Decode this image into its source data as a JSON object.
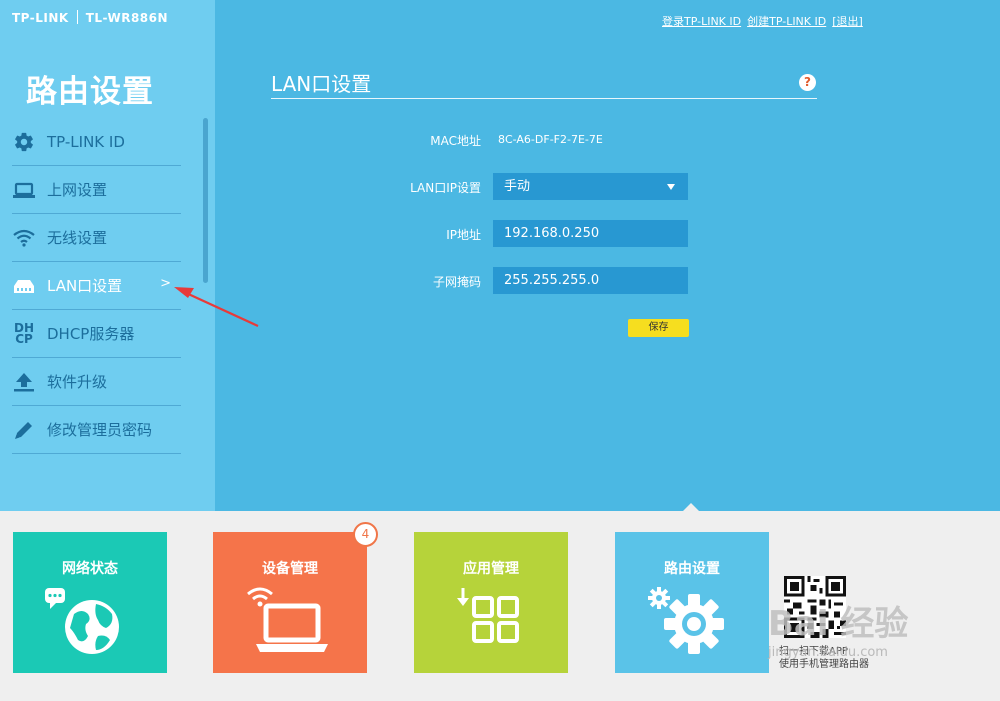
{
  "brand": {
    "logo": "TP-LINK",
    "model": "TL-WR886N"
  },
  "top_links": {
    "login": "登录TP-LINK ID",
    "create": "创建TP-LINK ID",
    "logout": "[退出]"
  },
  "sidebar": {
    "title": "路由设置",
    "items": [
      {
        "label": "TP-LINK ID",
        "icon": "gear-icon"
      },
      {
        "label": "上网设置",
        "icon": "laptop-icon"
      },
      {
        "label": "无线设置",
        "icon": "wifi-icon"
      },
      {
        "label": "LAN口设置",
        "icon": "router-icon",
        "active": true,
        "chevron": ">"
      },
      {
        "label": "DHCP服务器",
        "icon": "dhcp-icon",
        "icon_text": "DH CP"
      },
      {
        "label": "软件升级",
        "icon": "upload-icon"
      },
      {
        "label": "修改管理员密码",
        "icon": "pencil-icon"
      }
    ]
  },
  "panel": {
    "title": "LAN口设置",
    "help": "?",
    "mac_label": "MAC地址",
    "mac_value": "8C-A6-DF-F2-7E-7E",
    "ip_mode_label": "LAN口IP设置",
    "ip_mode_value": "手动",
    "ip_label": "IP地址",
    "ip_value": "192.168.0.250",
    "mask_label": "子网掩码",
    "mask_value": "255.255.255.0",
    "save": "保存"
  },
  "tiles": [
    {
      "label": "网络状态",
      "color": "#1bc9b5",
      "icon": "globe-icon"
    },
    {
      "label": "设备管理",
      "color": "#f5744a",
      "icon": "laptop-wifi-icon",
      "badge": "4"
    },
    {
      "label": "应用管理",
      "color": "#b6d33a",
      "icon": "apps-grid-icon"
    },
    {
      "label": "路由设置",
      "color": "#5ac3e8",
      "icon": "gears-icon"
    }
  ],
  "qr": {
    "caption_line1": "扫一扫下载APP",
    "caption_line2": "使用手机管理路由器"
  },
  "watermark": {
    "text": "Bai 经验",
    "sub": "jingyan.baidu.com"
  },
  "colors": {
    "sidebar": "#6fcdf0",
    "content": "#4bb8e3",
    "field": "#2898d2",
    "save": "#f6de1f",
    "annotation_arrow": "#e83a3a"
  }
}
